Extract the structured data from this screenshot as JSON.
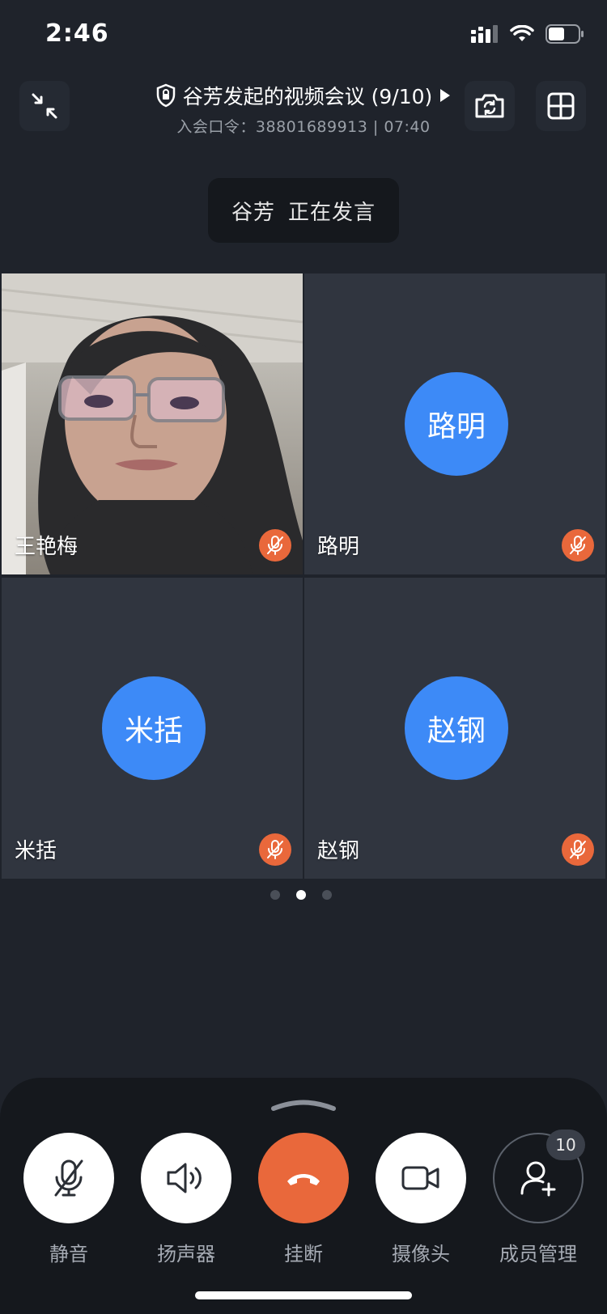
{
  "status_bar": {
    "time": "2:46"
  },
  "header": {
    "title": "谷芳发起的视频会议 (9/10)",
    "subtitle": "入会口令：38801689913 | 07:40"
  },
  "speaking": {
    "name": "谷芳",
    "status": "正在发言"
  },
  "tiles": [
    {
      "name": "王艳梅",
      "avatar_text": "",
      "has_video": true
    },
    {
      "name": "路明",
      "avatar_text": "路明",
      "has_video": false
    },
    {
      "name": "米括",
      "avatar_text": "米括",
      "has_video": false
    },
    {
      "name": "赵钢",
      "avatar_text": "赵钢",
      "has_video": false
    }
  ],
  "pager": {
    "pages": 3,
    "current_page": 2
  },
  "controls": {
    "mute": "静音",
    "speaker": "扬声器",
    "hangup": "挂断",
    "camera": "摄像头",
    "members": "成员管理",
    "member_count": "10"
  },
  "colors": {
    "accent_blue": "#3d8af7",
    "hangup_red": "#e9683b",
    "background": "#1f232b"
  },
  "icons": [
    "signal-icon",
    "wifi-icon",
    "battery-icon",
    "minimize-icon",
    "lock-shield-icon",
    "play-icon",
    "switch-camera-icon",
    "grid-layout-icon",
    "mic-off-icon",
    "speaker-icon",
    "hangup-icon",
    "video-camera-icon",
    "add-member-icon"
  ]
}
